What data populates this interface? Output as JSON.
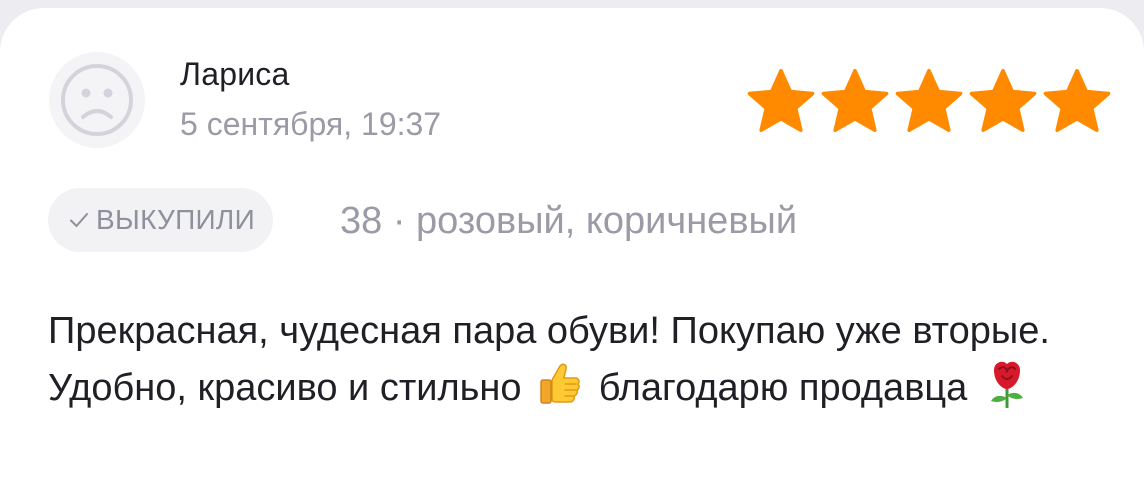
{
  "review": {
    "author": "Лариса",
    "date": "5 сентября, 19:37",
    "rating": 5,
    "rating_color": "#ff8a00",
    "badge": "ВЫКУПИЛИ",
    "variant": "38 · розовый, коричневый",
    "text_part1": "Прекрасная, чудесная пара обуви! Покупаю уже вторые. Удобно, красиво и стильно",
    "text_part2": "благодарю продавца",
    "icons": {
      "avatar": "sad-face-icon",
      "badge": "check-icon",
      "emoji1": "thumbs-up-emoji",
      "emoji2": "rose-emoji"
    }
  }
}
